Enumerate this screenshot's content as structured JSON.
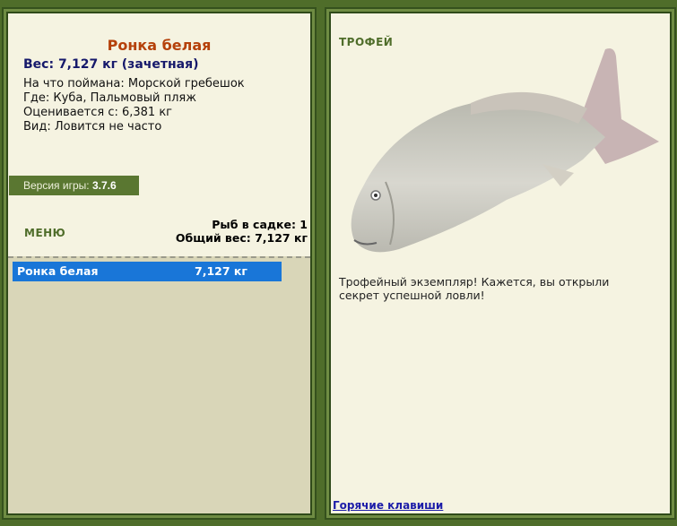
{
  "catch": {
    "fish_name": "Ронка белая",
    "weight": "Вес: 7,127 кг (зачетная)",
    "bait": "На что поймана: Морской гребешок",
    "location": "Где: Куба, Пальмовый пляж",
    "valued": "Оценивается с: 6,381 кг",
    "kind": "Вид: Ловится не часто"
  },
  "version": {
    "label": "Версия игры:",
    "value": "3.7.6"
  },
  "menu_label": "МЕНЮ",
  "keepnet": {
    "count": "Рыб в садке: 1",
    "total": "Общий вес: 7,127 кг",
    "items": [
      {
        "name": "Ронка белая",
        "weight": "7,127 кг"
      }
    ]
  },
  "trophy": {
    "title": "ТРОФЕЙ",
    "description": "Трофейный экземпляр! Кажется, вы открыли секрет успешной ловли!",
    "hotkeys": "Горячие клавиши"
  },
  "colors": {
    "background": "#4f6d2a",
    "panel": "#f5f3e1",
    "selection": "#1976d8"
  }
}
